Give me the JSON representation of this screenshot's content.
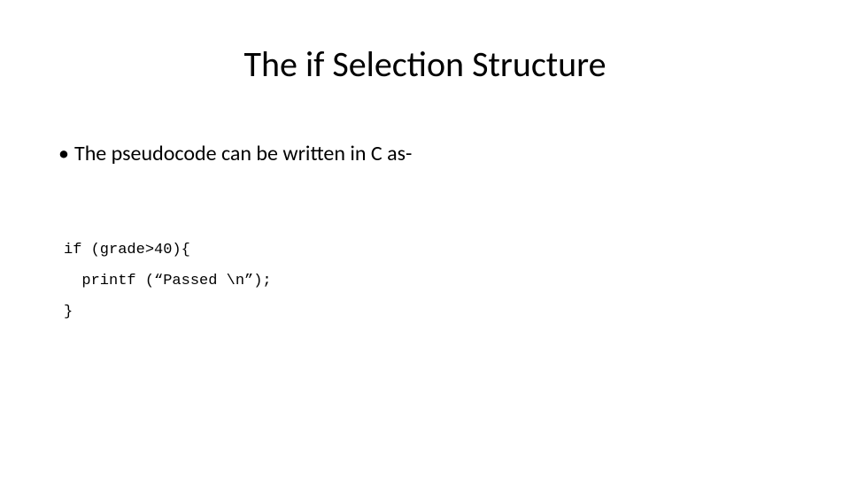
{
  "title": "The if Selection Structure",
  "bullets": [
    {
      "marker": "•",
      "text": "The pseudocode can be written in C as-"
    }
  ],
  "code": [
    "if (grade>40){",
    "  printf (“Passed \\n”);",
    "}"
  ]
}
